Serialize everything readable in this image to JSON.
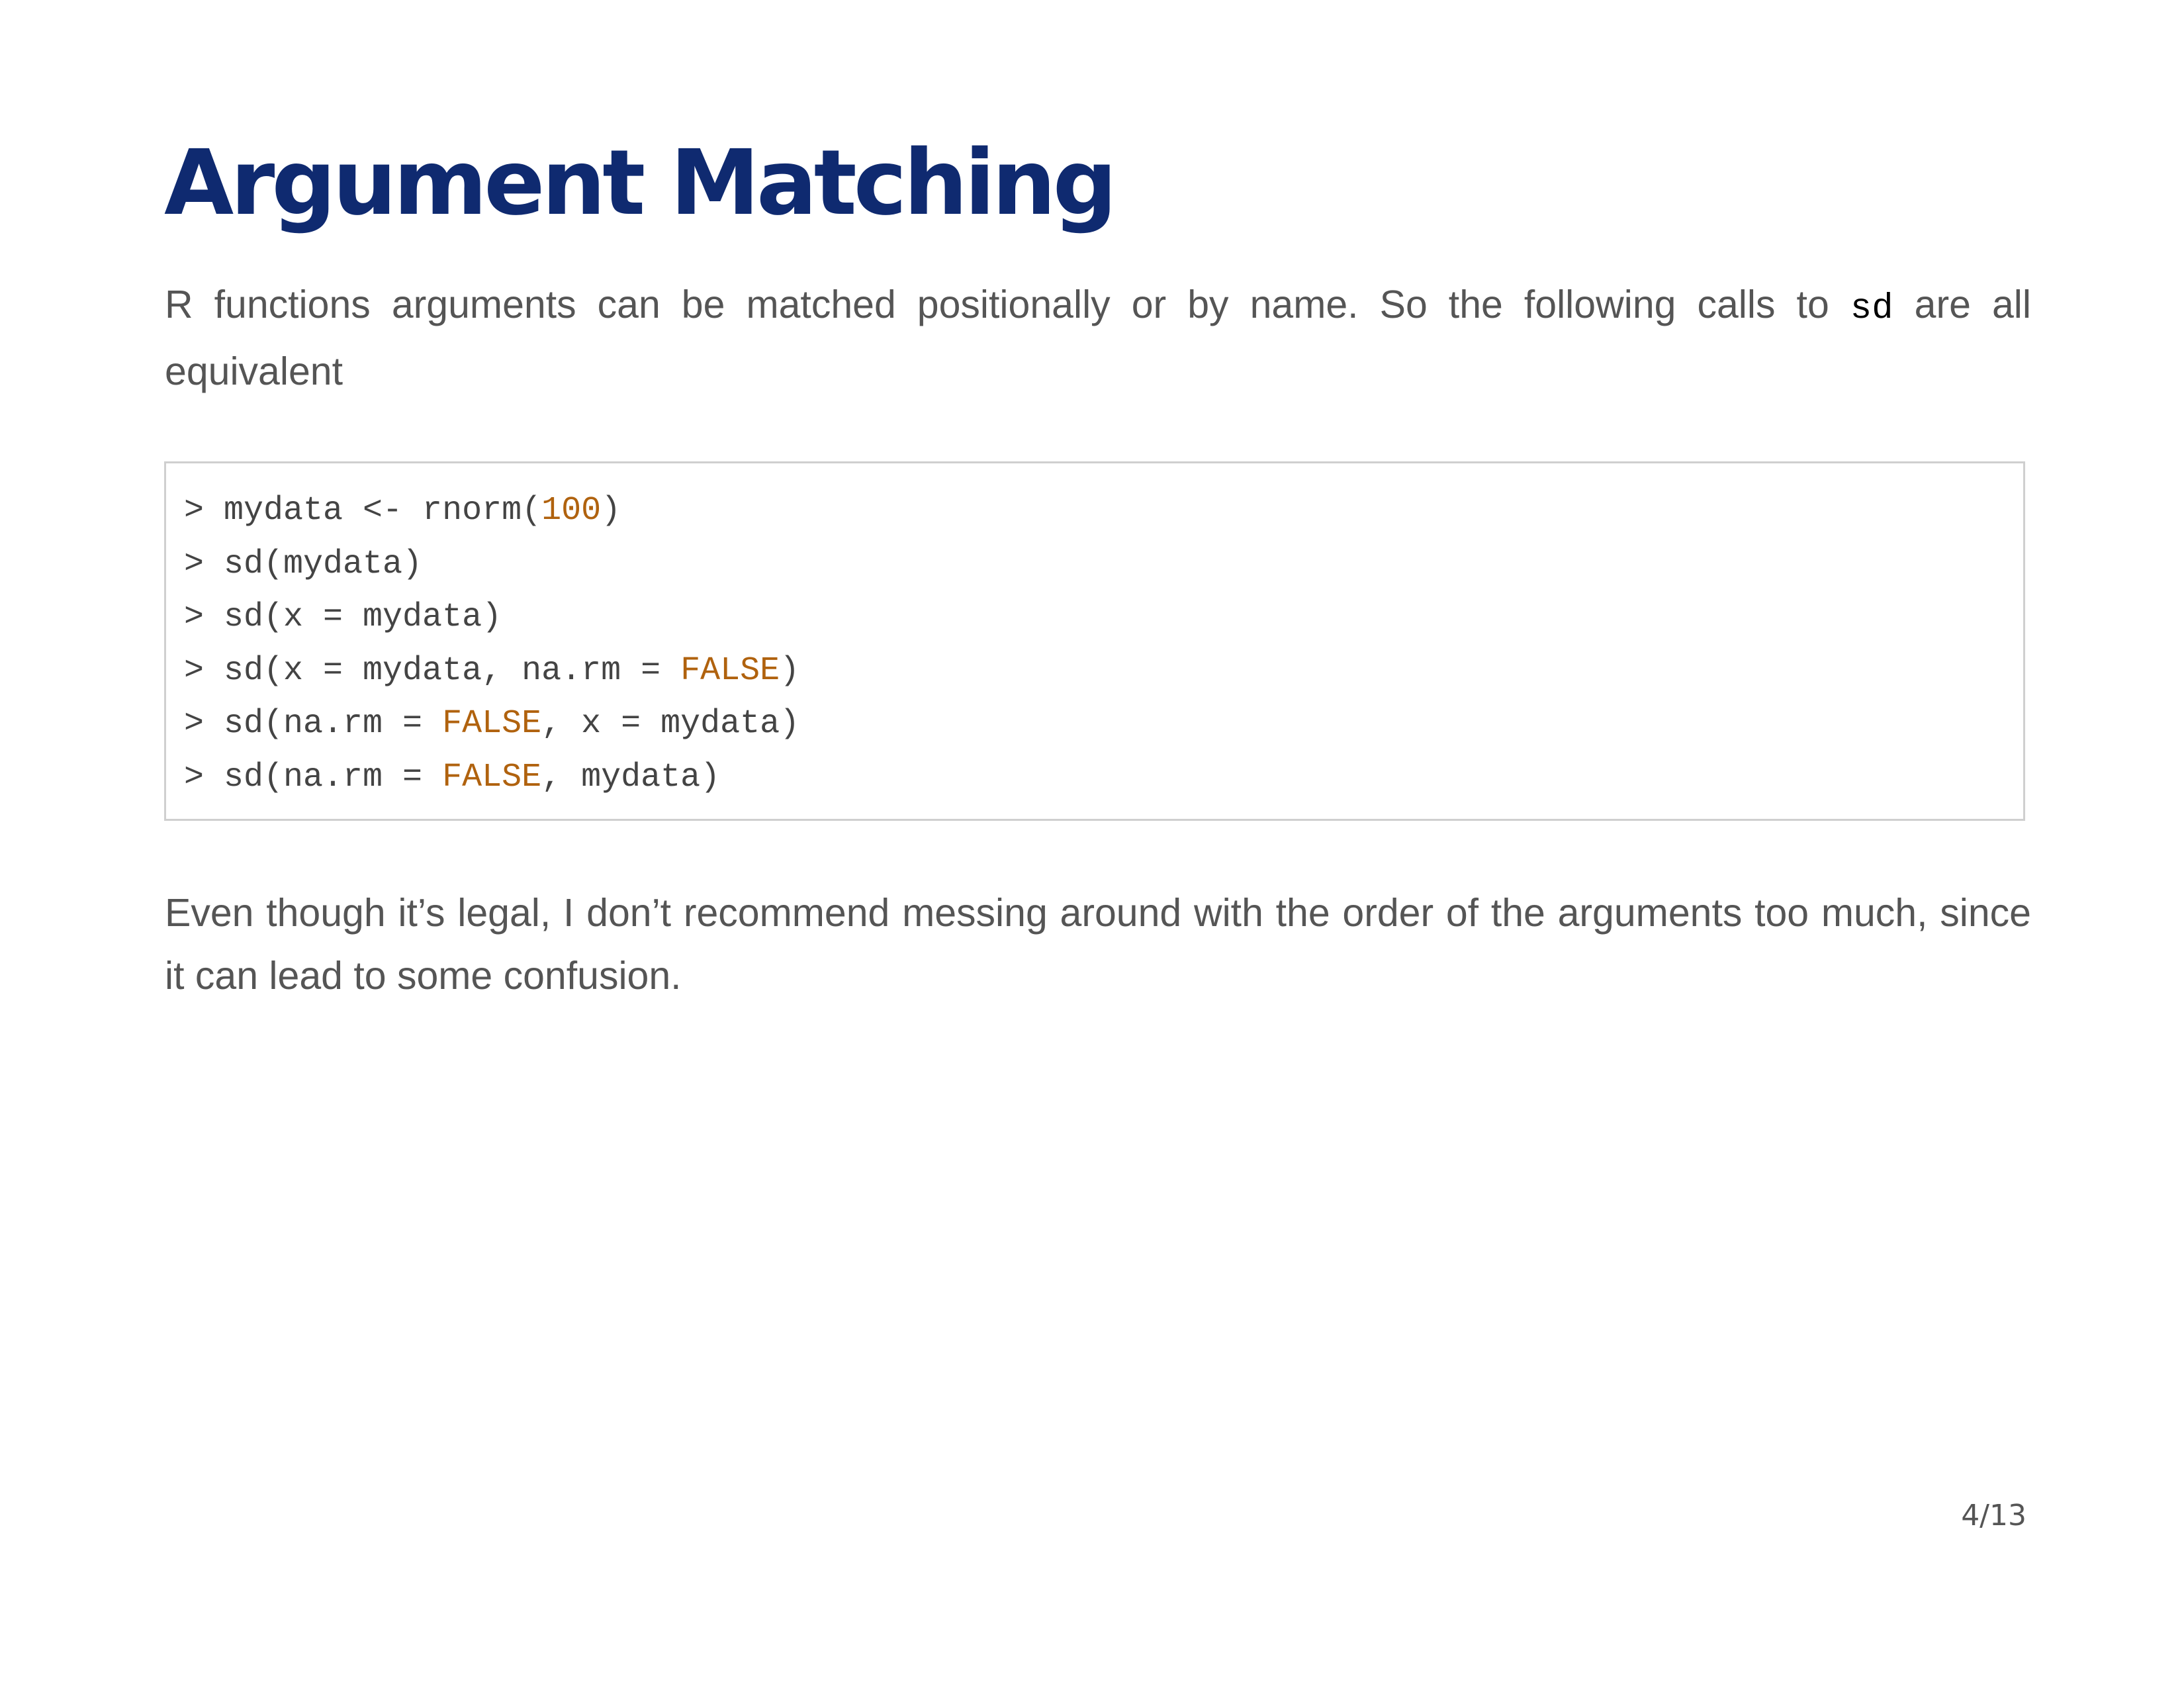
{
  "title": "Argument Matching",
  "intro": {
    "before": "R functions arguments can be matched positionally or by name. So the following calls to ",
    "code": "sd",
    "after": " are all equivalent"
  },
  "code_lines": [
    [
      {
        "t": "> mydata <- rnorm(",
        "c": "plain"
      },
      {
        "t": "100",
        "c": "num"
      },
      {
        "t": ")",
        "c": "plain"
      }
    ],
    [
      {
        "t": "> sd(mydata)",
        "c": "plain"
      }
    ],
    [
      {
        "t": "> sd(x = mydata)",
        "c": "plain"
      }
    ],
    [
      {
        "t": "> sd(x = mydata, na.rm = ",
        "c": "plain"
      },
      {
        "t": "FALSE",
        "c": "kw"
      },
      {
        "t": ")",
        "c": "plain"
      }
    ],
    [
      {
        "t": "> sd(na.rm = ",
        "c": "plain"
      },
      {
        "t": "FALSE",
        "c": "kw"
      },
      {
        "t": ", x = mydata)",
        "c": "plain"
      }
    ],
    [
      {
        "t": "> sd(na.rm = ",
        "c": "plain"
      },
      {
        "t": "FALSE",
        "c": "kw"
      },
      {
        "t": ", mydata)",
        "c": "plain"
      }
    ]
  ],
  "closing": "Even though it’s legal, I don’t recommend messing around with the order of the arguments too much, since it can lead to some confusion.",
  "page_number": "4/13",
  "colors": {
    "title": "#0f2a70",
    "body_text": "#555555",
    "code_text": "#444444",
    "code_literal": "#b0620e",
    "code_border": "#cfcfcf"
  }
}
